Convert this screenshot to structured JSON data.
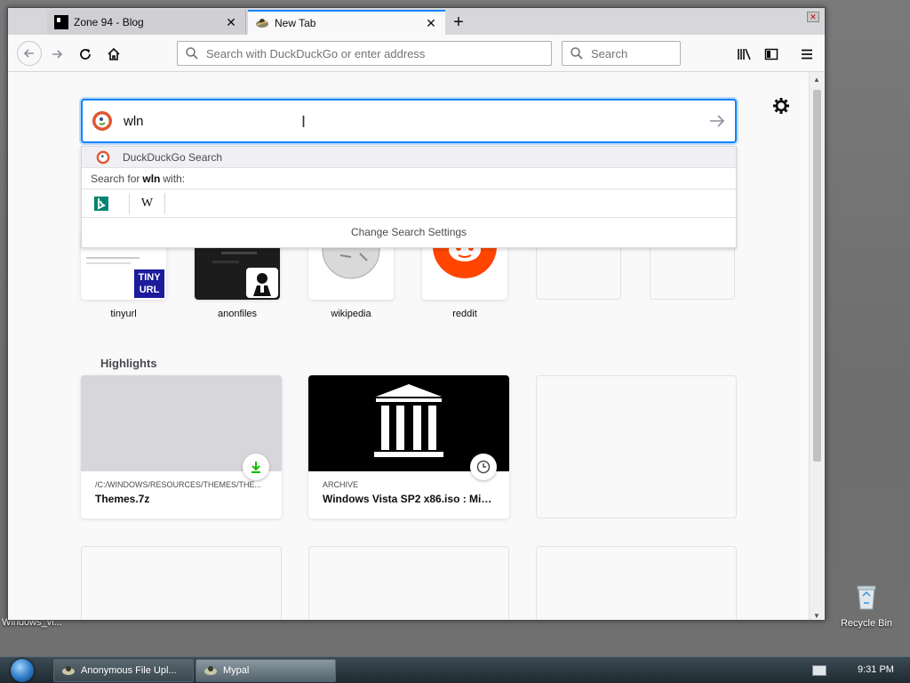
{
  "desktop": {
    "left_label": "Windows_vi...",
    "recycle_bin_label": "Recycle Bin"
  },
  "browser": {
    "tabs": [
      {
        "title": "Zone 94 - Blog",
        "active": false
      },
      {
        "title": "New Tab",
        "active": true
      }
    ],
    "urlbar_placeholder": "Search with DuckDuckGo or enter address",
    "searchbar_placeholder": "Search"
  },
  "newtab": {
    "search_value": "wln",
    "suggestions": {
      "engine_row_label": "DuckDuckGo Search",
      "search_for_prefix": "Search for",
      "search_for_term": "wln",
      "search_for_suffix": "with:",
      "engines": [
        "bing-icon",
        "wikipedia-icon"
      ],
      "change_settings": "Change Search Settings"
    },
    "top_sites": [
      {
        "name": "tinyurl"
      },
      {
        "name": "anonfiles"
      },
      {
        "name": "wikipedia"
      },
      {
        "name": "reddit"
      },
      {
        "name": ""
      },
      {
        "name": ""
      }
    ],
    "highlights_title": "Highlights",
    "highlights": [
      {
        "source": "/C:/WINDOWS/RESOURCES/THEMES/THE...",
        "title": "Themes.7z",
        "badge": "download-icon"
      },
      {
        "source": "ARCHIVE",
        "title": "Windows Vista SP2 x86.iso : Micr...",
        "badge": "clock-icon"
      }
    ]
  },
  "taskbar": {
    "buttons": [
      {
        "label": "Anonymous File Upl...",
        "active": false
      },
      {
        "label": "Mypal",
        "active": true
      }
    ],
    "clock": "9:31 PM"
  },
  "colors": {
    "accent": "#0a84ff",
    "reddit": "#ff4500",
    "bing": "#008373"
  }
}
